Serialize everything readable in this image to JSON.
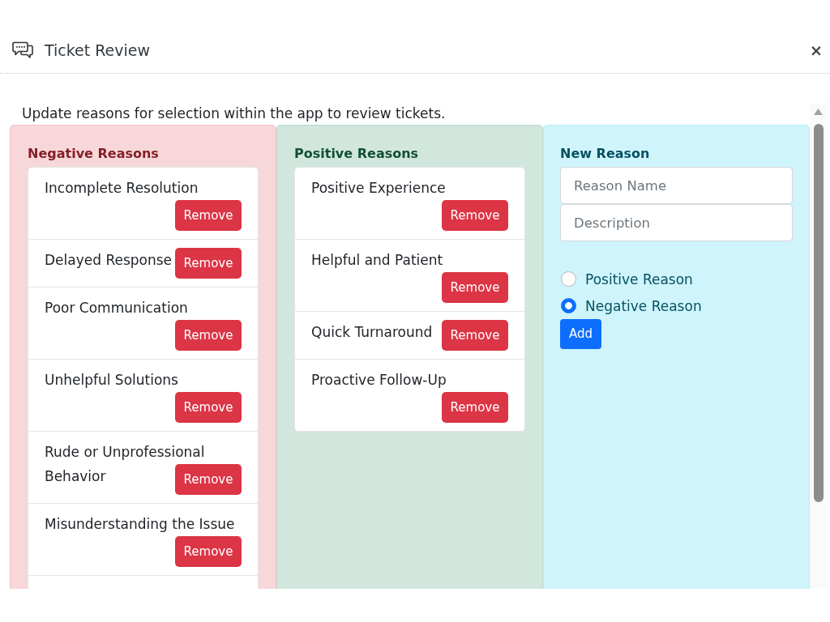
{
  "dialog": {
    "title": "Ticket Review",
    "close": "×"
  },
  "description": "Update reasons for selection within the app to review tickets.",
  "columns": [
    {
      "kind": "negative",
      "title": "Negative Reasons",
      "more_below": true,
      "items": [
        {
          "name": "Incomplete Resolution",
          "button": "Remove"
        },
        {
          "name": "Delayed Response",
          "button": "Remove"
        },
        {
          "name": "Poor Communication",
          "button": "Remove"
        },
        {
          "name": "Unhelpful Solutions",
          "button": "Remove"
        },
        {
          "name": "Rude or Unprofessional Behavior",
          "button": "Remove"
        },
        {
          "name": "Misunderstanding the Issue",
          "button": "Remove"
        }
      ]
    },
    {
      "kind": "positive",
      "title": "Positive Reasons",
      "more_below": false,
      "items": [
        {
          "name": "Positive Experience",
          "button": "Remove"
        },
        {
          "name": "Helpful and Patient",
          "button": "Remove"
        },
        {
          "name": "Quick Turnaround",
          "button": "Remove"
        },
        {
          "name": "Proactive Follow-Up",
          "button": "Remove"
        }
      ]
    },
    {
      "kind": "form",
      "title": "New Reason",
      "fields": [
        {
          "placeholder": "Reason Name"
        },
        {
          "placeholder": "Description"
        }
      ],
      "options": [
        {
          "label": "Positive Reason",
          "selected": false
        },
        {
          "label": "Negative Reason",
          "selected": true
        }
      ],
      "button": "Add"
    }
  ]
}
